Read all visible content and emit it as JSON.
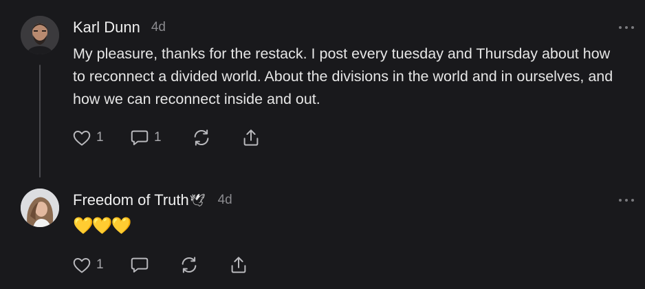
{
  "comments": [
    {
      "author": "Karl Dunn",
      "timestamp": "4d",
      "text": "My pleasure, thanks for the restack. I post every tuesday and Thursday about how to reconnect a divided world. About the divisions in the world and in ourselves, and how we can reconnect inside and out.",
      "likes": "1",
      "replies": "1"
    },
    {
      "author": "Freedom of Truth",
      "author_badge": "🕊",
      "timestamp": "4d",
      "text": "💛💛💛",
      "likes": "1",
      "replies": ""
    }
  ],
  "icons": {
    "like": "heart-icon",
    "reply": "speech-bubble-icon",
    "restack": "restack-arrows-icon",
    "share": "share-upload-icon",
    "more": "more-options-icon"
  },
  "colors": {
    "background": "#19191c",
    "text": "#e6e6e6",
    "muted": "#8a8a8e",
    "icon": "#b9b9bd"
  }
}
